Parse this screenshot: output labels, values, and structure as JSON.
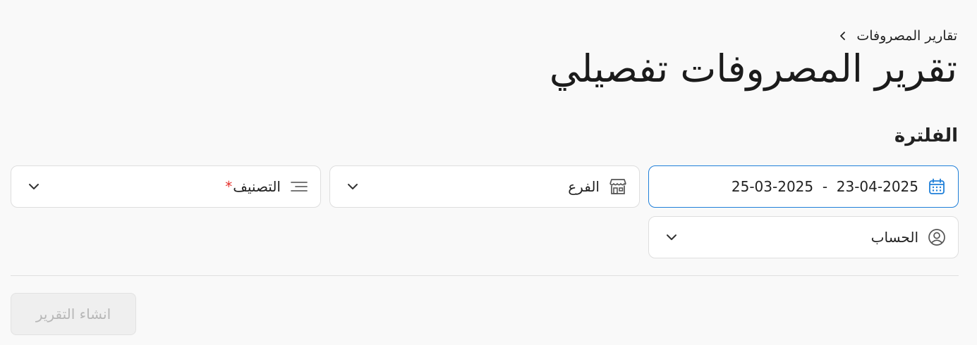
{
  "breadcrumb": {
    "label": "تقارير المصروفات",
    "icon": "chevron-left-icon"
  },
  "page_title": "تقرير المصروفات تفصيلي",
  "filter_section": {
    "title": "الفلترة",
    "date_range": {
      "value": "25-03-2025  -  23-04-2025",
      "icon": "calendar-icon",
      "accent": "#1f7fd9"
    },
    "branch": {
      "label": "الفرع",
      "icon": "store-icon"
    },
    "classification": {
      "label": "التصنيف",
      "required_mark": "*",
      "icon": "filter-lines-icon"
    },
    "account": {
      "label": "الحساب",
      "icon": "user-circle-icon"
    }
  },
  "actions": {
    "generate_label": "انشاء التقرير",
    "generate_disabled": true
  }
}
